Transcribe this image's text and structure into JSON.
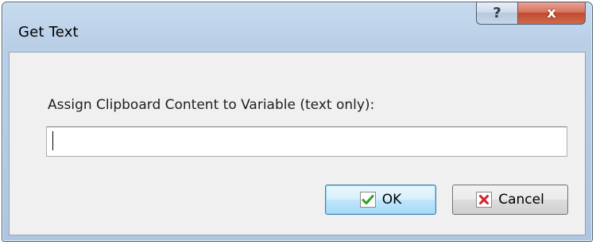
{
  "window": {
    "title": "Get Text"
  },
  "caption": {
    "help_symbol": "?",
    "close_symbol": "x"
  },
  "form": {
    "prompt_label": "Assign Clipboard Content to Variable (text only):",
    "input_value": "",
    "input_placeholder": ""
  },
  "buttons": {
    "ok_label": "OK",
    "cancel_label": "Cancel",
    "ok_icon": "green-checkmark-icon",
    "cancel_icon": "red-x-icon"
  },
  "colors": {
    "ok_icon": "#2fa024",
    "cancel_icon": "#d3202a"
  }
}
